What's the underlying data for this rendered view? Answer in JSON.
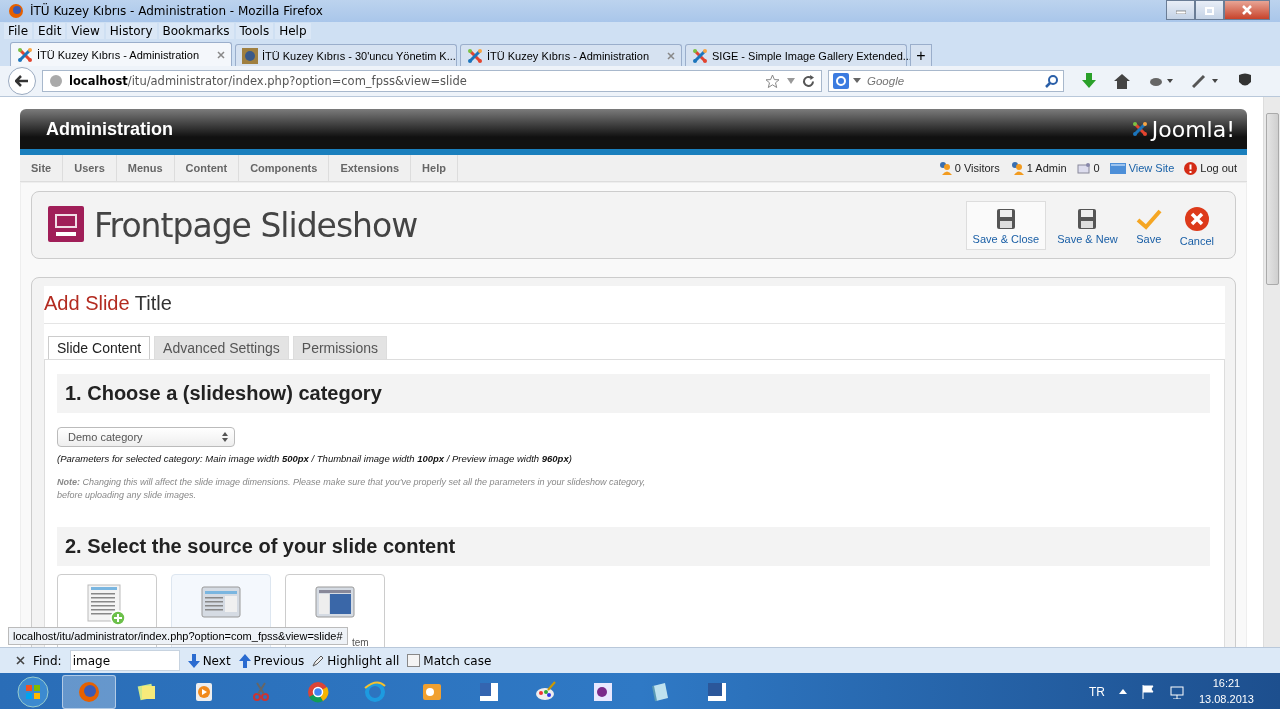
{
  "window": {
    "title": "İTÜ Kuzey Kıbrıs - Administration - Mozilla Firefox"
  },
  "menu": [
    "File",
    "Edit",
    "View",
    "History",
    "Bookmarks",
    "Tools",
    "Help"
  ],
  "browser_tabs": [
    {
      "title": "İTÜ Kuzey Kıbrıs - Administration",
      "selected": true,
      "kind": "joomla"
    },
    {
      "title": "İTÜ Kuzey Kıbrıs - 30'uncu Yönetim K...",
      "selected": false,
      "kind": "site"
    },
    {
      "title": "İTÜ Kuzey Kıbrıs - Administration",
      "selected": false,
      "kind": "joomla"
    },
    {
      "title": "SIGE - Simple Image Gallery Extended...",
      "selected": false,
      "kind": "joomla"
    }
  ],
  "new_tab": "+",
  "address": {
    "host": "localhost",
    "path": "/itu/administrator/index.php?option=com_fpss&view=slide"
  },
  "search": {
    "placeholder": "Google"
  },
  "header": {
    "title": "Administration",
    "logo": "Joomla!"
  },
  "admin_menu": [
    "Site",
    "Users",
    "Menus",
    "Content",
    "Components",
    "Extensions",
    "Help"
  ],
  "status_items": [
    {
      "kind": "visitors",
      "text": "0 Visitors"
    },
    {
      "kind": "admin",
      "text": "1 Admin"
    },
    {
      "kind": "messages",
      "text": "0"
    },
    {
      "kind": "view-site",
      "text": "View Site"
    },
    {
      "kind": "logout",
      "text": "Log out"
    }
  ],
  "page_title": "Frontpage Slideshow",
  "toolbar": [
    {
      "kind": "save",
      "label": "Save & Close",
      "highlighted": true
    },
    {
      "kind": "save",
      "label": "Save & New",
      "highlighted": false
    },
    {
      "kind": "check",
      "label": "Save",
      "highlighted": false
    },
    {
      "kind": "cancel",
      "label": "Cancel",
      "highlighted": false
    }
  ],
  "form": {
    "title_action": "Add Slide",
    "title_rest": "Title",
    "tabs": [
      {
        "label": "Slide Content",
        "selected": true
      },
      {
        "label": "Advanced Settings",
        "selected": false
      },
      {
        "label": "Permissions",
        "selected": false
      }
    ],
    "section_1": {
      "heading": "1. Choose a (slideshow) category",
      "select": "Demo category",
      "params": "(Parameters for selected category: Main image width **500px** / Thumbnail image width **100px** / Preview image width **960px**)",
      "note": "**Note:** Changing this will affect the slide image dimensions. Please make sure that you've properly set all the parameters in your slideshow category, before uploading any slide images."
    },
    "section_2": {
      "heading": "2. Select the source of your slide content",
      "sources": [
        {
          "kind": "new-document",
          "highlighted": false
        },
        {
          "kind": "window",
          "highlighted": true
        },
        {
          "kind": "blue-window",
          "highlighted": false,
          "label": "tem"
        }
      ]
    }
  },
  "link_tooltip": "localhost/itu/administrator/index.php?option=com_fpss&view=slide#",
  "find_bar": {
    "label": "Find:",
    "value": "image",
    "next": "Next",
    "previous": "Previous",
    "highlight": "Highlight all",
    "match_case": {
      "label": "Match case",
      "checked": false
    }
  },
  "taskbar": {
    "apps": [
      {
        "kind": "firefox",
        "active": true
      },
      {
        "kind": "notes",
        "active": false
      },
      {
        "kind": "media",
        "active": false
      },
      {
        "kind": "scissors",
        "active": false
      },
      {
        "kind": "chrome",
        "active": false
      },
      {
        "kind": "ie",
        "active": false
      },
      {
        "kind": "outlook",
        "active": false
      },
      {
        "kind": "visio",
        "active": false
      },
      {
        "kind": "paint",
        "active": false
      },
      {
        "kind": "access",
        "active": false
      },
      {
        "kind": "notepad",
        "active": false
      },
      {
        "kind": "word",
        "active": false
      }
    ],
    "language": "TR",
    "time": "16:21",
    "date": "13.08.2013"
  }
}
